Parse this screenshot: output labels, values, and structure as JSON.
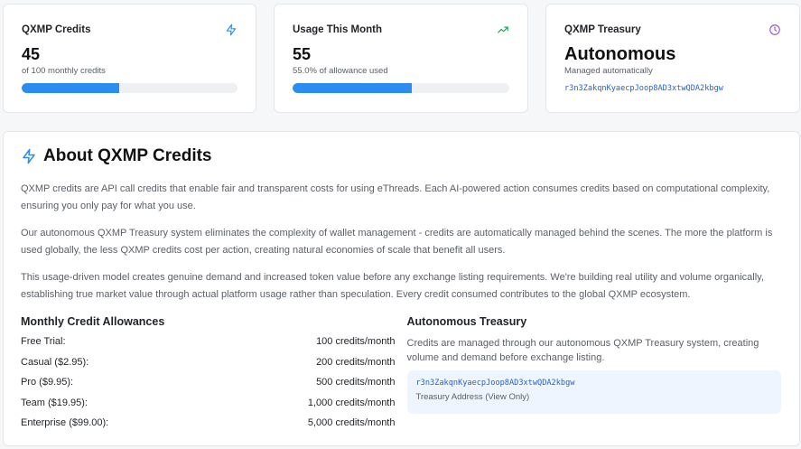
{
  "stats": {
    "credits": {
      "title": "QXMP Credits",
      "value": "45",
      "sub": "of 100 monthly credits",
      "progress": 0.45,
      "icon": "lightning-icon",
      "icon_color": "#2b8df0"
    },
    "usage": {
      "title": "Usage This Month",
      "value": "55",
      "sub": "55.0% of allowance used",
      "progress": 0.55,
      "icon": "trending-up-icon",
      "icon_color": "#22a35a"
    },
    "treasury": {
      "title": "QXMP Treasury",
      "value": "Autonomous",
      "sub": "Managed automatically",
      "address": "r3n3ZakqnKyaecpJoop8AD3xtwQDA2kbgw",
      "icon": "clock-icon",
      "icon_color": "#9b59d0"
    }
  },
  "about": {
    "title": "About QXMP Credits",
    "icon": "lightning-icon",
    "paragraphs": [
      "QXMP credits are API call credits that enable fair and transparent costs for using eThreads. Each AI-powered action consumes credits based on computational complexity, ensuring you only pay for what you use.",
      "Our autonomous QXMP Treasury system eliminates the complexity of wallet management - credits are automatically managed behind the scenes. The more the platform is used globally, the less QXMP credits cost per action, creating natural economies of scale that benefit all users.",
      "This usage-driven model creates genuine demand and increased token value before any exchange listing requirements. We're building real utility and volume organically, establishing true market value through actual platform usage rather than speculation. Every credit consumed contributes to the global QXMP ecosystem."
    ],
    "allowances": {
      "title": "Monthly Credit Allowances",
      "tiers": [
        {
          "name": "Free Trial:",
          "amount": "100 credits/month"
        },
        {
          "name": "Casual ($2.95):",
          "amount": "200 credits/month"
        },
        {
          "name": "Pro ($9.95):",
          "amount": "500 credits/month"
        },
        {
          "name": "Team ($19.95):",
          "amount": "1,000 credits/month"
        },
        {
          "name": "Enterprise ($99.00):",
          "amount": "5,000 credits/month"
        }
      ]
    },
    "treasury": {
      "title": "Autonomous Treasury",
      "text": "Credits are managed through our autonomous QXMP Treasury system, creating volume and demand before exchange listing.",
      "address": "r3n3ZakqnKyaecpJoop8AD3xtwQDA2kbgw",
      "address_label": "Treasury Address (View Only)"
    }
  },
  "colors": {
    "accent": "#2b8df0",
    "address_link": "#2563c9",
    "address_box_bg": "#eef5fe"
  }
}
